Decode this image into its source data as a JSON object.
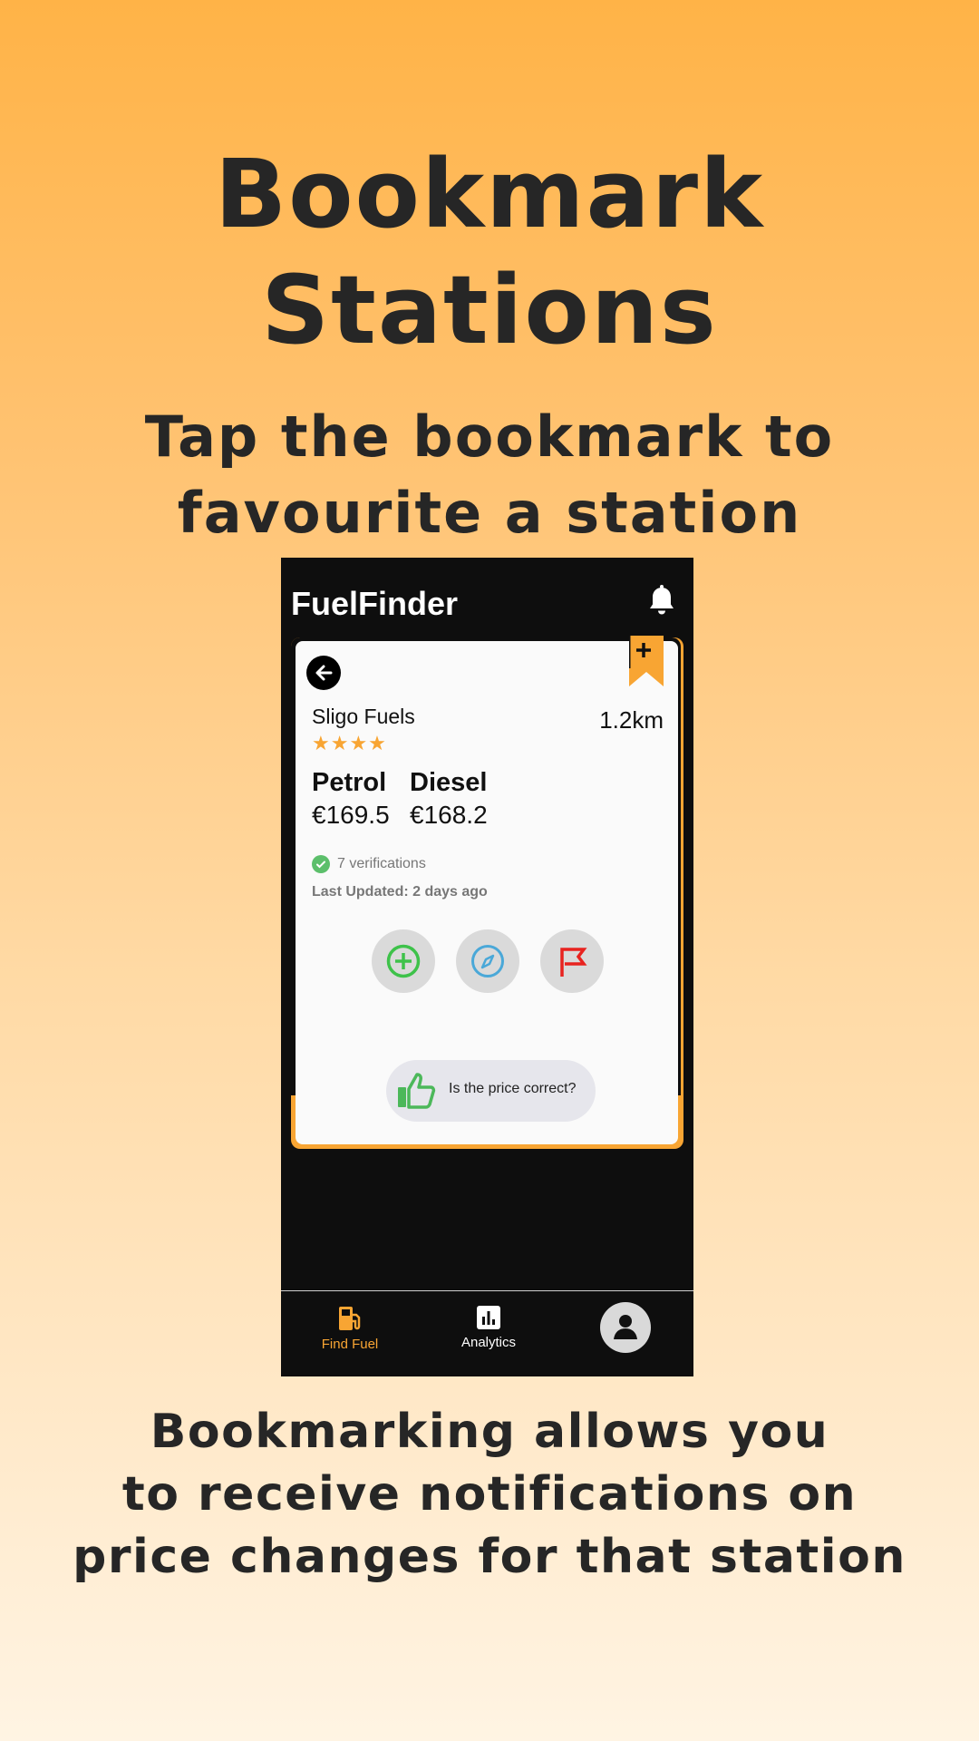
{
  "promo": {
    "title_line1": "Bookmark",
    "title_line2": "Stations",
    "subtitle_line1": "Tap the bookmark to",
    "subtitle_line2": "favourite a station",
    "footer_line1": "Bookmarking allows you",
    "footer_line2": "to receive notifications on",
    "footer_line3": "price changes for that station"
  },
  "app": {
    "title": "FuelFinder",
    "header_icon": "bell-icon"
  },
  "station": {
    "name": "Sligo Fuels",
    "distance": "1.2km",
    "rating": 4,
    "stars_text": "★★★★",
    "fuels": [
      {
        "name": "Petrol",
        "price": "€169.5"
      },
      {
        "name": "Diesel",
        "price": "€168.2"
      }
    ],
    "verifications": "7 verifications",
    "last_updated": "Last Updated: 2 days ago",
    "actions": [
      "add-price-icon",
      "compass-icon",
      "flag-icon"
    ],
    "price_check_label": "Is the price correct?",
    "bookmarked": true
  },
  "nav": {
    "items": [
      {
        "label": "Find Fuel",
        "icon": "fuel-pump-icon",
        "active": true
      },
      {
        "label": "Analytics",
        "icon": "bar-chart-icon",
        "active": false
      }
    ],
    "profile_icon": "profile-icon"
  },
  "colors": {
    "accent": "#f8a533",
    "verify_green": "#5cbf6b",
    "compass_blue": "#4aa8d8",
    "flag_red": "#e8231f",
    "add_green": "#3ec24a"
  }
}
